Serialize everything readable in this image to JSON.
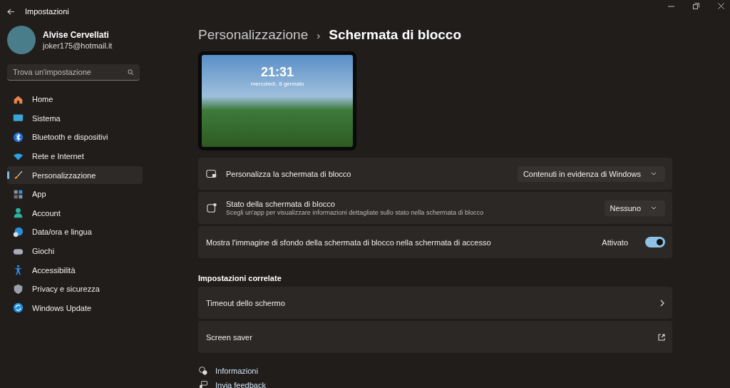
{
  "window": {
    "title": "Impostazioni"
  },
  "user": {
    "name": "Alvise Cervellati",
    "email": "joker175@hotmail.it"
  },
  "search": {
    "placeholder": "Trova un'impostazione"
  },
  "sidebar": {
    "items": [
      {
        "label": "Home",
        "selected": false
      },
      {
        "label": "Sistema",
        "selected": false
      },
      {
        "label": "Bluetooth e dispositivi",
        "selected": false
      },
      {
        "label": "Rete e Internet",
        "selected": false
      },
      {
        "label": "Personalizzazione",
        "selected": true
      },
      {
        "label": "App",
        "selected": false
      },
      {
        "label": "Account",
        "selected": false
      },
      {
        "label": "Data/ora e lingua",
        "selected": false
      },
      {
        "label": "Giochi",
        "selected": false
      },
      {
        "label": "Accessibilità",
        "selected": false
      },
      {
        "label": "Privacy e sicurezza",
        "selected": false
      },
      {
        "label": "Windows Update",
        "selected": false
      }
    ]
  },
  "breadcrumb": {
    "parent": "Personalizzazione",
    "separator": "›",
    "current": "Schermata di blocco"
  },
  "preview": {
    "time": "21:31",
    "date": "mercoledì, 8 gennaio"
  },
  "settings": [
    {
      "kind": "dropdown",
      "title": "Personalizza la schermata di blocco",
      "value": "Contenuti in evidenza di Windows"
    },
    {
      "kind": "dropdown",
      "title": "Stato della schermata di blocco",
      "description": "Scegli un'app per visualizzare informazioni dettagliate sullo stato nella schermata di blocco",
      "value": "Nessuno"
    },
    {
      "kind": "toggle",
      "title": "Mostra l'immagine di sfondo della schermata di blocco nella schermata di accesso",
      "state_label": "Attivato",
      "on": true
    }
  ],
  "related": {
    "heading": "Impostazioni correlate",
    "items": [
      {
        "kind": "chevron",
        "title": "Timeout dello schermo"
      },
      {
        "kind": "external",
        "title": "Screen saver"
      }
    ]
  },
  "footer_links": [
    {
      "label": "Informazioni"
    },
    {
      "label": "Invia feedback"
    }
  ]
}
